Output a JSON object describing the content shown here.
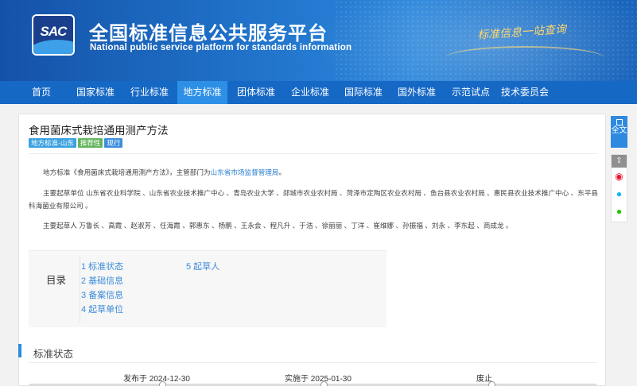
{
  "header": {
    "logo_text": "SAC",
    "title": "全国标准信息公共服务平台",
    "subtitle": "National public service platform  for standards information",
    "slogan": "标准信息一站查询"
  },
  "nav": {
    "items": [
      {
        "label": "首页"
      },
      {
        "label": "国家标准"
      },
      {
        "label": "行业标准"
      },
      {
        "label": "地方标准",
        "active": true
      },
      {
        "label": "团体标准"
      },
      {
        "label": "企业标准"
      },
      {
        "label": "国际标准"
      },
      {
        "label": "国外标准"
      },
      {
        "label": "示范试点"
      },
      {
        "label": "技术委员会"
      }
    ]
  },
  "doc": {
    "title": "食用菌床式栽培通用测产方法",
    "badges": [
      "地方标准-山东",
      "推荐性",
      "现行"
    ],
    "intro_prefix": "地方标准《食用菌床式栽培通用测产方法》，主管部门为",
    "intro_link": "山东省市场监督管理局",
    "intro_suffix": "。",
    "drafting_units": "主要起草单位 山东省农业科学院 、山东省农业技术推广中心 、青岛农业大学 、郯城市农业农村局 、菏泽市定陶区农业农村局 、鱼台县农业农村局 、惠民县农业技术推广中心 、东平县科海菌业有限公司 。",
    "drafters": "主要起草人 万鲁长 、高霞 、赵淑芳 、任海霞 、郭惠东 、杨鹏 、王永会 、程凡升 、于浩 、徐丽丽 、丁洋 、崔维娜 、孙振福 、刘永 、李东起 、商成龙 。"
  },
  "toc": {
    "heading": "目录",
    "items": [
      "1  标准状态",
      "2  基础信息",
      "3  备案信息",
      "4  起草单位",
      "5  起草人"
    ]
  },
  "status": {
    "section_title": "标准状态",
    "published": "发布于 2024-12-30",
    "effective": "实施于 2025-01-30",
    "abolished": "废止"
  },
  "tools": {
    "full_text": "全文"
  }
}
